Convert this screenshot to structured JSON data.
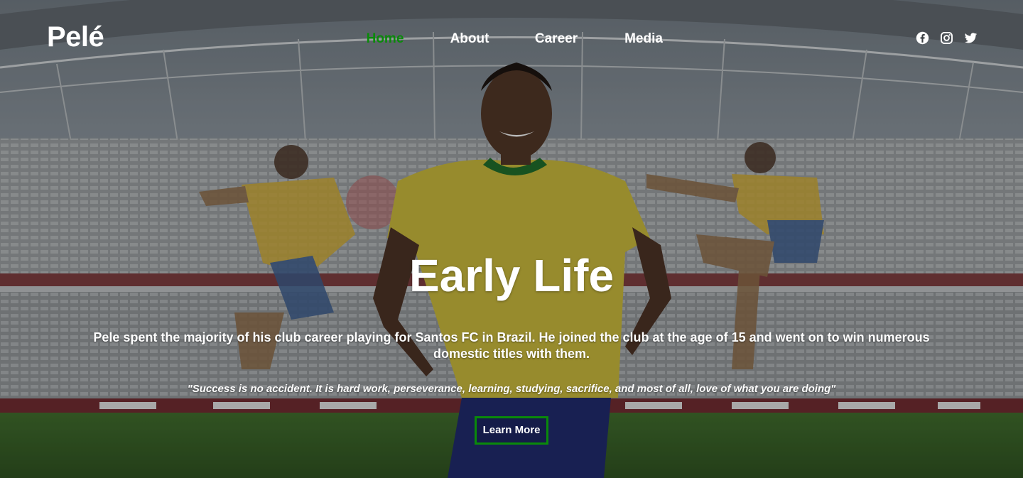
{
  "brand": {
    "logo": "Pelé"
  },
  "nav": {
    "items": [
      {
        "label": "Home",
        "active": true
      },
      {
        "label": "About",
        "active": false
      },
      {
        "label": "Career",
        "active": false
      },
      {
        "label": "Media",
        "active": false
      }
    ]
  },
  "social": [
    {
      "icon": "facebook-icon"
    },
    {
      "icon": "instagram-icon"
    },
    {
      "icon": "twitter-icon"
    }
  ],
  "hero": {
    "title": "Early Life",
    "description": "Pele spent the majority of his club career playing for Santos FC in Brazil. He joined the club at the age of 15 and went on to win numerous domestic titles with them.",
    "quote": "\"Success is no accident. It is hard work, perseverance, learning, studying, sacrifice, and most of all, love of what you are doing\"",
    "cta_label": "Learn More"
  },
  "colors": {
    "accent": "#0a8a0a",
    "text": "#ffffff"
  }
}
